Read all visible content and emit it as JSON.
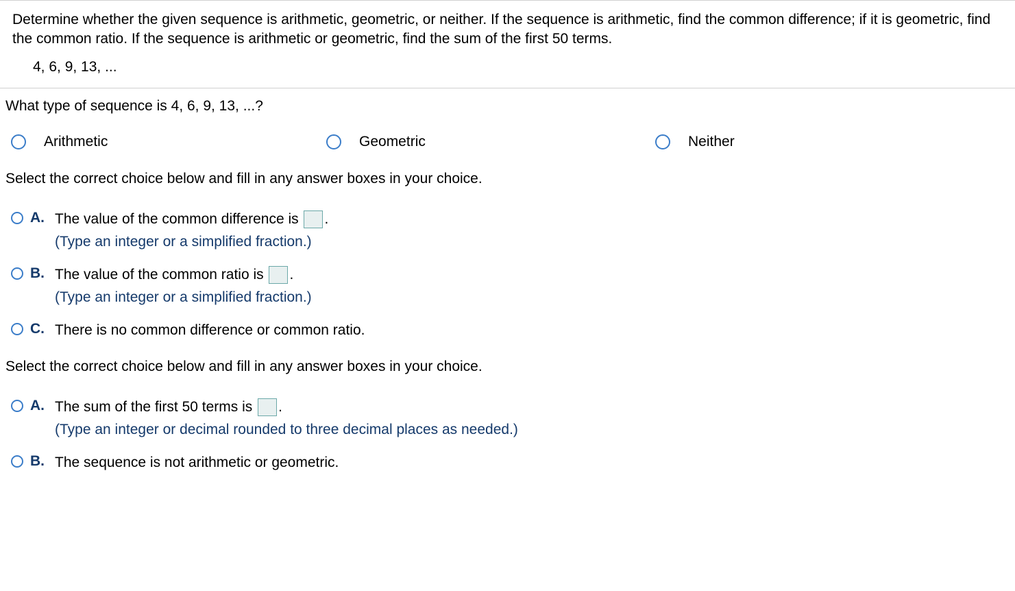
{
  "problem": {
    "text": "Determine whether the given sequence is arithmetic, geometric, or neither. If the sequence is arithmetic, find the common difference; if it is geometric, find the common ratio. If the sequence is arithmetic or geometric, find the sum of the first 50 terms.",
    "sequence": "4, 6, 9, 13, ..."
  },
  "q1": {
    "prompt": "What type of sequence is 4, 6, 9, 13, ...?",
    "options": {
      "arithmetic": "Arithmetic",
      "geometric": "Geometric",
      "neither": "Neither"
    }
  },
  "q2": {
    "instruction": "Select the correct choice below and fill in any answer boxes in your choice.",
    "choices": {
      "a": {
        "letter": "A.",
        "text_before": "The value of the common difference is ",
        "text_after": ".",
        "hint": "(Type an integer or a simplified fraction.)"
      },
      "b": {
        "letter": "B.",
        "text_before": "The value of the common ratio is ",
        "text_after": ".",
        "hint": "(Type an integer or a simplified fraction.)"
      },
      "c": {
        "letter": "C.",
        "text": "There is no common difference or common ratio."
      }
    }
  },
  "q3": {
    "instruction": "Select the correct choice below and fill in any answer boxes in your choice.",
    "choices": {
      "a": {
        "letter": "A.",
        "text_before": "The sum of the first 50 terms is ",
        "text_after": ".",
        "hint": "(Type an integer or decimal rounded to three decimal places as needed.)"
      },
      "b": {
        "letter": "B.",
        "text": "The sequence is not arithmetic or geometric."
      }
    }
  }
}
